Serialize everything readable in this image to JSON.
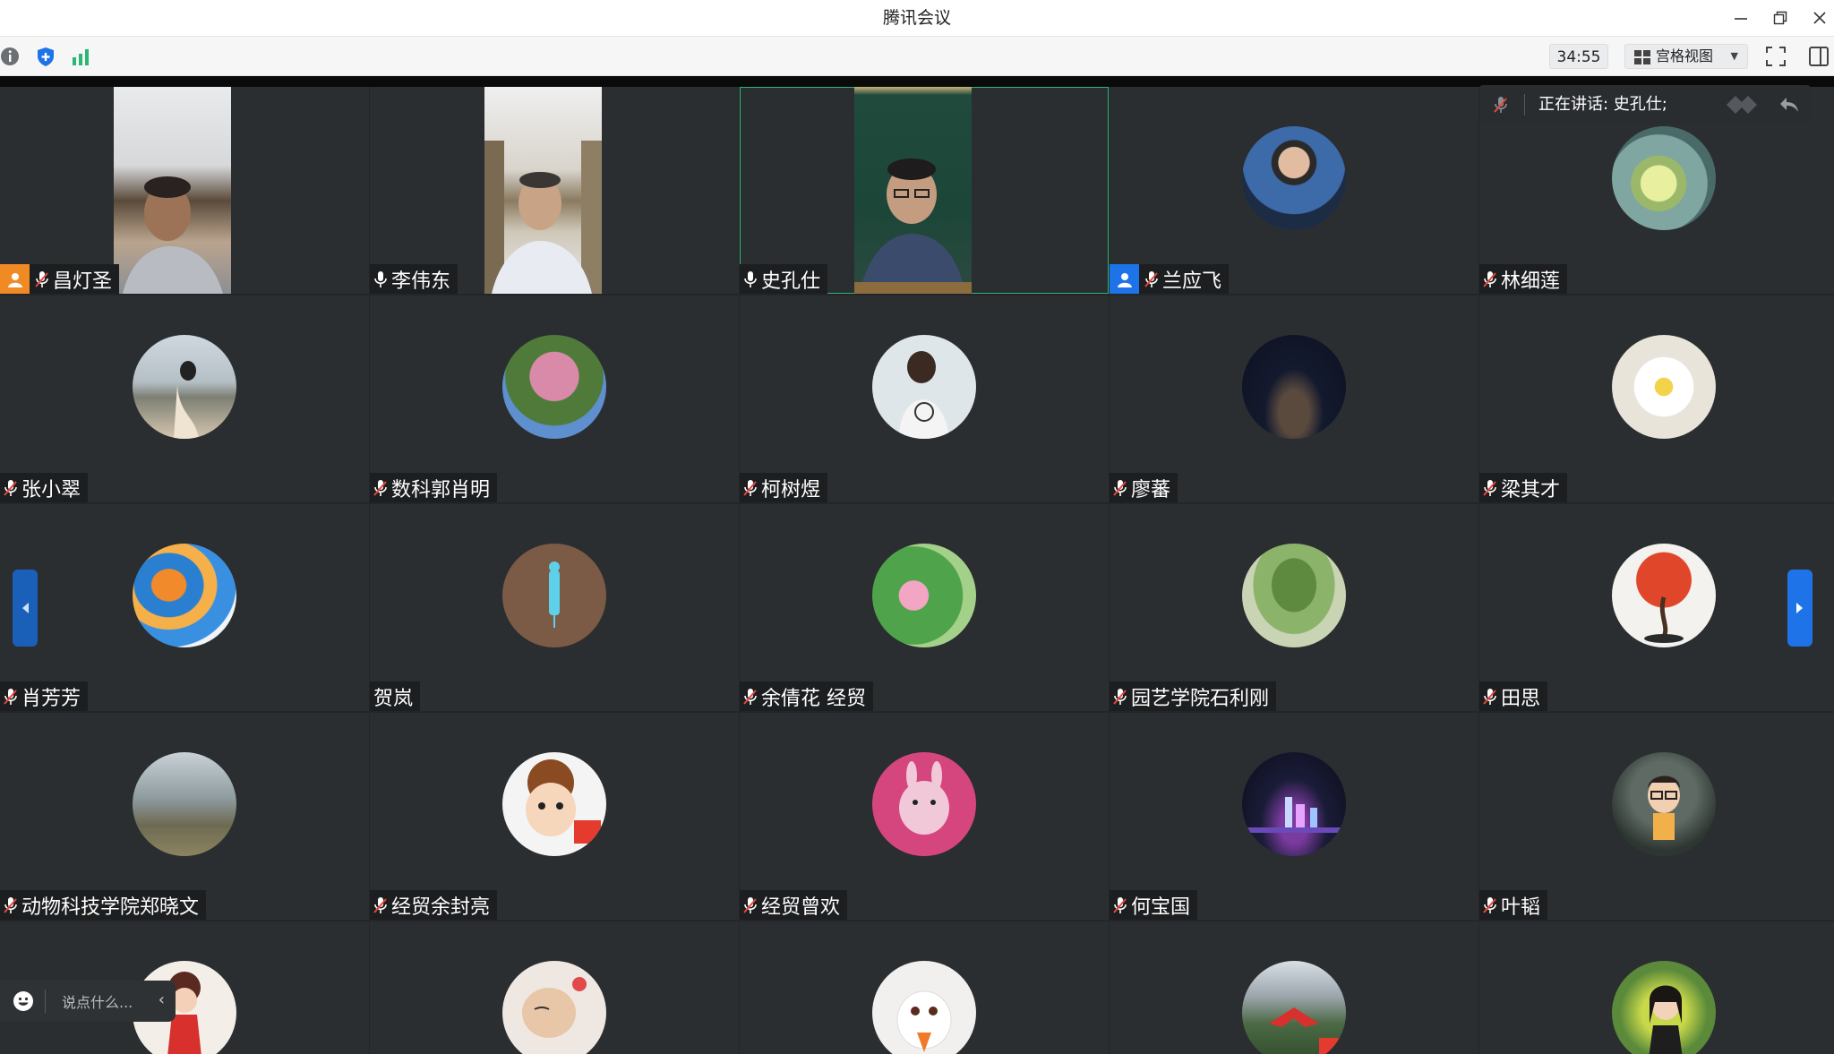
{
  "window": {
    "title": "腾讯会议",
    "minimize_icon": "minimize-icon",
    "restore_icon": "restore-icon",
    "close_icon": "close-icon"
  },
  "toolbar": {
    "info_icon": "info-icon",
    "security_icon": "shield-icon",
    "network_icon": "signal-bars-icon",
    "timer": "34:55",
    "view_label": "宫格视图",
    "fullscreen_icon": "fullscreen-icon",
    "sidepanel_icon": "side-panel-icon"
  },
  "speaking": {
    "label": "正在讲话: 史孔仕;"
  },
  "participants": [
    {
      "name": "昌灯圣",
      "mic": "muted",
      "host_badge": true,
      "badge_color": "#f08a24",
      "media": "video"
    },
    {
      "name": "李伟东",
      "mic": "on",
      "media": "video"
    },
    {
      "name": "史孔仕",
      "mic": "on",
      "media": "video",
      "active_speaker": true
    },
    {
      "name": "兰应飞",
      "mic": "muted",
      "host_badge": true,
      "badge_color": "#1e73e8",
      "media": "avatar"
    },
    {
      "name": "林细莲",
      "mic": "muted",
      "media": "avatar"
    },
    {
      "name": "张小翠",
      "mic": "muted",
      "media": "avatar"
    },
    {
      "name": "数科郭肖明",
      "mic": "muted",
      "media": "avatar"
    },
    {
      "name": "柯树煜",
      "mic": "muted",
      "media": "avatar"
    },
    {
      "name": "廖蕃",
      "mic": "muted",
      "media": "avatar"
    },
    {
      "name": "梁其才",
      "mic": "muted",
      "media": "avatar"
    },
    {
      "name": "肖芳芳",
      "mic": "muted",
      "media": "avatar"
    },
    {
      "name": "贺岚",
      "mic": "none",
      "media": "avatar"
    },
    {
      "name": "余倩花 经贸",
      "mic": "muted",
      "media": "avatar"
    },
    {
      "name": "园艺学院石利刚",
      "mic": "muted",
      "media": "avatar"
    },
    {
      "name": "田思",
      "mic": "muted",
      "media": "avatar"
    },
    {
      "name": "动物科技学院郑晓文",
      "mic": "muted",
      "media": "avatar"
    },
    {
      "name": "经贸余封亮",
      "mic": "muted",
      "media": "avatar"
    },
    {
      "name": "经贸曾欢",
      "mic": "muted",
      "media": "avatar"
    },
    {
      "name": "何宝国",
      "mic": "muted",
      "media": "avatar"
    },
    {
      "name": "叶韬",
      "mic": "muted",
      "media": "avatar"
    },
    {
      "name": "",
      "mic": "none",
      "media": "avatar"
    },
    {
      "name": "",
      "mic": "none",
      "media": "avatar"
    },
    {
      "name": "",
      "mic": "none",
      "media": "avatar"
    },
    {
      "name": "",
      "mic": "none",
      "media": "avatar"
    },
    {
      "name": "",
      "mic": "none",
      "media": "avatar"
    }
  ],
  "chat": {
    "placeholder": "说点什么...",
    "emoji_icon": "emoji-icon",
    "collapse_icon": "chevron-left-icon"
  },
  "nav": {
    "prev_icon": "arrow-left-icon",
    "next_icon": "arrow-right-icon"
  },
  "colors": {
    "tile_bg": "#2b2e31",
    "accent_blue": "#1e73e8",
    "active_border": "#2bb673",
    "mic_muted": "#e5483f"
  }
}
